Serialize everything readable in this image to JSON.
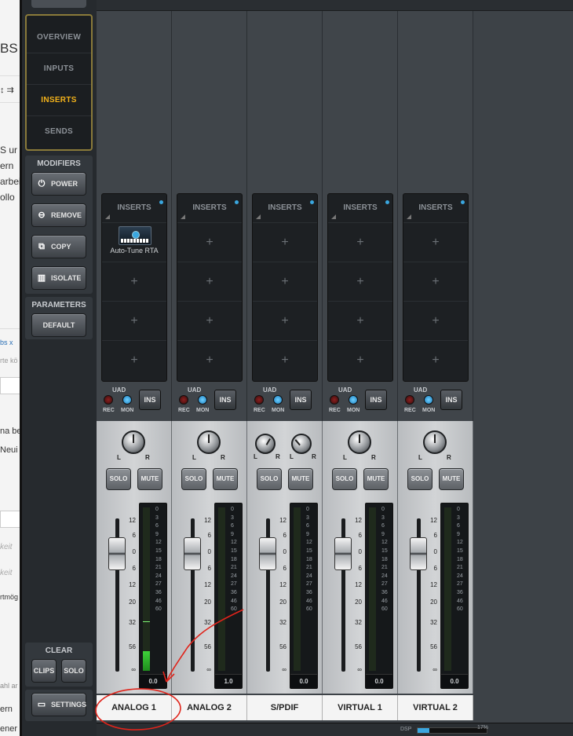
{
  "background_page": {
    "fragments": [
      "BS",
      "S ur",
      "ern",
      "arbei",
      "ollo",
      "bs  x",
      "rte kö",
      "na be",
      "Neui",
      "keit",
      "keit",
      "rtmög",
      "ahl ar",
      "ern",
      "ener"
    ]
  },
  "navigation": {
    "items": [
      {
        "label": "OVERVIEW",
        "active": false
      },
      {
        "label": "INPUTS",
        "active": false
      },
      {
        "label": "INSERTS",
        "active": true
      },
      {
        "label": "SENDS",
        "active": false
      }
    ]
  },
  "modifiers": {
    "title": "MODIFIERS",
    "buttons": [
      {
        "label": "POWER",
        "icon": "power-icon"
      },
      {
        "label": "REMOVE",
        "icon": "remove-icon"
      },
      {
        "label": "COPY",
        "icon": "copy-icon"
      },
      {
        "label": "ISOLATE",
        "icon": "isolate-icon"
      }
    ]
  },
  "parameters": {
    "title": "PARAMETERS",
    "default_label": "DEFAULT"
  },
  "clear": {
    "title": "CLEAR",
    "clips_label": "CLIPS",
    "solo_label": "SOLO"
  },
  "settings_label": "SETTINGS",
  "inserts_header": "INSERTS",
  "rec_labels": {
    "uad": "UAD",
    "rec": "REC",
    "mon": "MON",
    "ins": "INS"
  },
  "mixer_labels": {
    "solo": "SOLO",
    "mute": "MUTE",
    "l": "L",
    "r": "R"
  },
  "fader_scale": [
    "12",
    "6",
    "0",
    "6",
    "12",
    "20",
    "32",
    "56",
    "∞"
  ],
  "meter_scale": [
    "0",
    "3",
    "6",
    "9",
    "12",
    "15",
    "18",
    "21",
    "24",
    "27",
    "36",
    "46",
    "60"
  ],
  "channels": [
    {
      "name": "ANALOG 1",
      "plugin": "Auto-Tune RTA",
      "meter_value": "0.0",
      "meter_level": 0.12,
      "meter_peak": 0.3,
      "stereo": false,
      "selected": true
    },
    {
      "name": "ANALOG 2",
      "plugin": "",
      "meter_value": "1.0",
      "meter_level": 0,
      "meter_peak": 0,
      "stereo": false,
      "selected": false
    },
    {
      "name": "S/PDIF",
      "plugin": "",
      "meter_value": "0.0",
      "meter_level": 0,
      "meter_peak": 0,
      "stereo": true,
      "selected": false
    },
    {
      "name": "VIRTUAL 1",
      "plugin": "",
      "meter_value": "0.0",
      "meter_level": 0,
      "meter_peak": 0,
      "stereo": false,
      "selected": false
    },
    {
      "name": "VIRTUAL 2",
      "plugin": "",
      "meter_value": "0.0",
      "meter_level": 0,
      "meter_peak": 0,
      "stereo": false,
      "selected": false
    }
  ],
  "status": {
    "dsp_label": "DSP",
    "dsp_value": "17%",
    "dsp_level": 0.17
  },
  "colors": {
    "accent_active": "#f3b21a",
    "annotation": "#e0241b",
    "meter_green": "#3ed23a",
    "mon_blue": "#3aa7e0"
  }
}
